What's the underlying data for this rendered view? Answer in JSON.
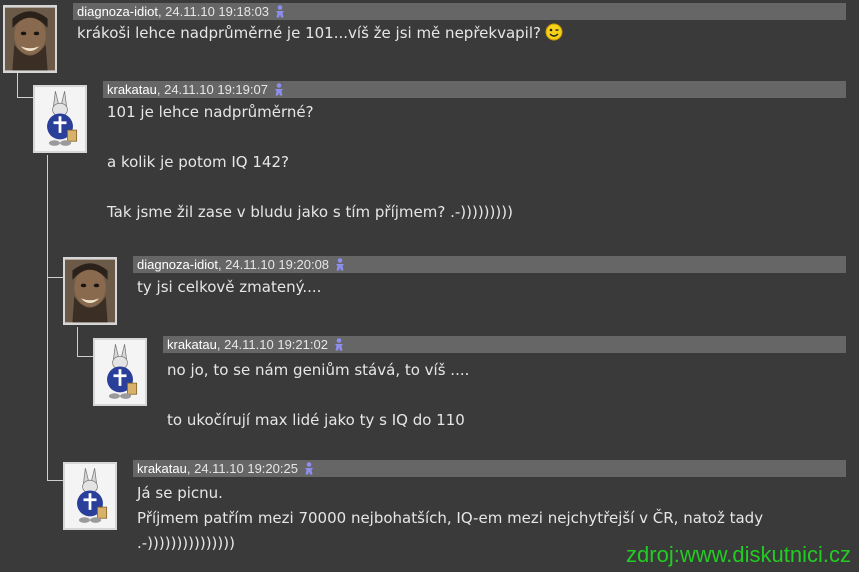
{
  "posts": [
    {
      "author": "diagnoza-idiot",
      "timestamp": ", 24.11.10 19:18:03",
      "avatar": "portrait",
      "lines": [
        "krákoši lehce nadprůměrné je 101...víš že jsi mě nepřekvapil?"
      ],
      "smiley": "wink-icon"
    },
    {
      "author": "krakatau",
      "timestamp": ", 24.11.10 19:19:07",
      "avatar": "rabbit",
      "lines": [
        "101 je lehce nadprůměrné?",
        "",
        "a kolik je potom IQ 142?",
        "",
        "Tak jsme žil zase v bludu jako s tím příjmem? .-)))))))))"
      ]
    },
    {
      "author": "diagnoza-idiot",
      "timestamp": ", 24.11.10 19:20:08",
      "avatar": "portrait",
      "lines": [
        "ty jsi celkově zmatený...."
      ]
    },
    {
      "author": "krakatau",
      "timestamp": ", 24.11.10 19:21:02",
      "avatar": "rabbit",
      "lines": [
        "no jo, to se nám geniům stává, to víš ....",
        "",
        "to ukočírují max lidé jako ty s IQ do 110"
      ]
    },
    {
      "author": "krakatau",
      "timestamp": ", 24.11.10 19:20:25",
      "avatar": "rabbit",
      "lines": [
        "Já se picnu.",
        "Příjmem patřím mezi 70000 nejbohatších, IQ-em mezi nejchytřejší v ČR, natož tady",
        ".-)))))))))))))))"
      ]
    }
  ],
  "watermark": "zdroj:www.diskutnici.cz",
  "colors": {
    "background": "#3a3a3a",
    "header": "#666666",
    "watermark": "#22cc22"
  }
}
